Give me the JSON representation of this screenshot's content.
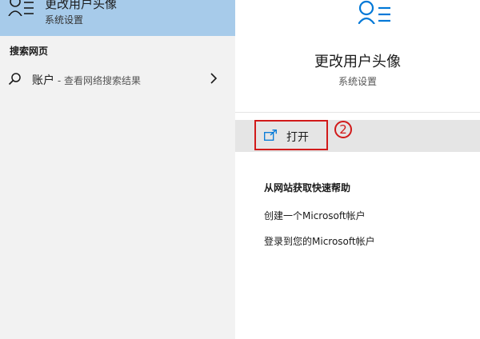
{
  "best_match": {
    "title": "更改用户头像",
    "subtitle": "系统设置",
    "icon": "user-accounts-icon"
  },
  "web_section": {
    "label": "搜索网页",
    "item": {
      "query": "账户",
      "hint": " - 查看网络搜索结果",
      "icon": "search-icon"
    }
  },
  "details": {
    "title": "更改用户头像",
    "subtitle": "系统设置",
    "open_label": "打开",
    "step_number": "2",
    "help_title": "从网站获取快速帮助",
    "help_links": [
      "创建一个Microsoft帐户",
      "登录到您的Microsoft帐户"
    ]
  },
  "colors": {
    "highlight": "#a7cbea",
    "annotation": "#d11a1a",
    "accent": "#0078d7"
  }
}
